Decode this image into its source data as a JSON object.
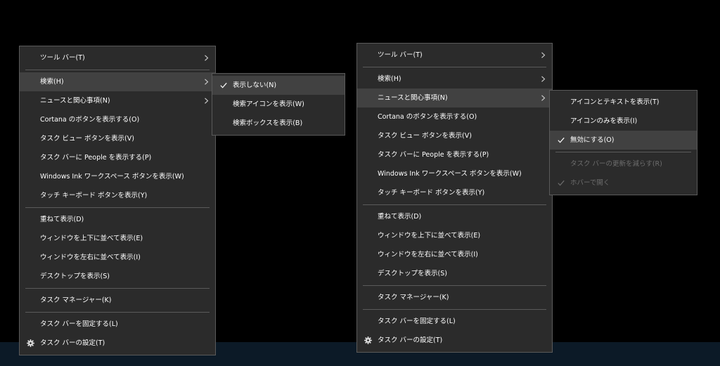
{
  "left_menu": {
    "items": [
      {
        "label": "ツール バー(T)"
      },
      {
        "label": "検索(H)"
      },
      {
        "label": "ニュースと関心事項(N)"
      },
      {
        "label": "Cortana のボタンを表示する(O)"
      },
      {
        "label": "タスク ビュー ボタンを表示(V)"
      },
      {
        "label": "タスク バーに People を表示する(P)"
      },
      {
        "label": "Windows Ink ワークスペース ボタンを表示(W)"
      },
      {
        "label": "タッチ キーボード ボタンを表示(Y)"
      },
      {
        "label": "重ねて表示(D)"
      },
      {
        "label": "ウィンドウを上下に並べて表示(E)"
      },
      {
        "label": "ウィンドウを左右に並べて表示(I)"
      },
      {
        "label": "デスクトップを表示(S)"
      },
      {
        "label": "タスク マネージャー(K)"
      },
      {
        "label": "タスク バーを固定する(L)"
      },
      {
        "label": "タスク バーの設定(T)"
      }
    ]
  },
  "search_submenu": {
    "items": [
      {
        "label": "表示しない(N)",
        "checked": true
      },
      {
        "label": "検索アイコンを表示(W)"
      },
      {
        "label": "検索ボックスを表示(B)"
      }
    ]
  },
  "right_menu": {
    "items": [
      {
        "label": "ツール バー(T)"
      },
      {
        "label": "検索(H)"
      },
      {
        "label": "ニュースと関心事項(N)"
      },
      {
        "label": "Cortana のボタンを表示する(O)"
      },
      {
        "label": "タスク ビュー ボタンを表示(V)"
      },
      {
        "label": "タスク バーに People を表示する(P)"
      },
      {
        "label": "Windows Ink ワークスペース ボタンを表示(W)"
      },
      {
        "label": "タッチ キーボード ボタンを表示(Y)"
      },
      {
        "label": "重ねて表示(D)"
      },
      {
        "label": "ウィンドウを上下に並べて表示(E)"
      },
      {
        "label": "ウィンドウを左右に並べて表示(I)"
      },
      {
        "label": "デスクトップを表示(S)"
      },
      {
        "label": "タスク マネージャー(K)"
      },
      {
        "label": "タスク バーを固定する(L)"
      },
      {
        "label": "タスク バーの設定(T)"
      }
    ]
  },
  "news_submenu": {
    "items": [
      {
        "label": "アイコンとテキストを表示(T)"
      },
      {
        "label": "アイコンのみを表示(I)"
      },
      {
        "label": "無効にする(O)",
        "checked": true
      },
      {
        "label": "タスク バーの更新を減らす(R)",
        "disabled": true
      },
      {
        "label": "ホバーで開く",
        "checked": true,
        "disabled": true
      }
    ]
  },
  "icons": {
    "submenu_arrow": "chevron-right-icon",
    "checkmark": "checkmark-icon",
    "settings": "gear-icon"
  },
  "colors": {
    "menu_background": "#2b2b2b",
    "highlight": "#414141",
    "separator": "#5a5a5a",
    "disabled_text": "#6d6d6d",
    "taskbar": "#0c1a27"
  }
}
